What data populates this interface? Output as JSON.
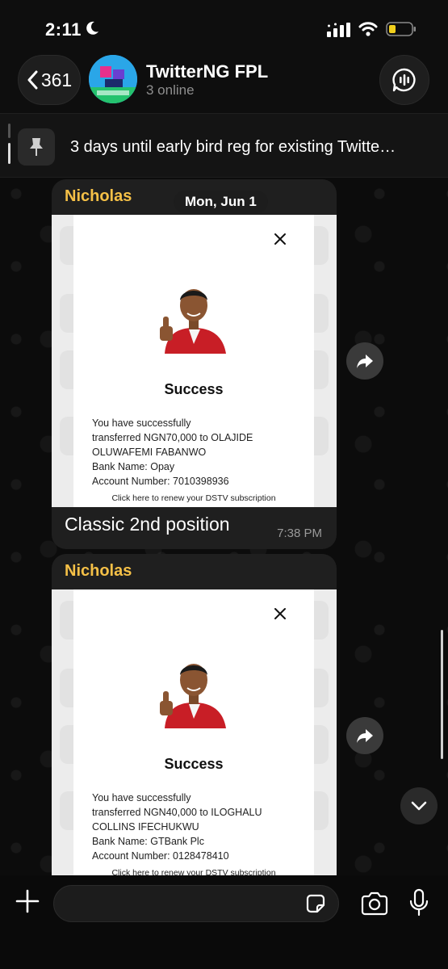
{
  "status_bar": {
    "time": "2:11"
  },
  "header": {
    "back_count": "361",
    "title": "TwitterNG FPL",
    "subtitle": "3 online"
  },
  "pinned": {
    "text": "3 days until early bird reg for existing Twitte…"
  },
  "date_separator": "Mon, Jun 1",
  "messages": [
    {
      "sender": "Nicholas",
      "receipt": {
        "status": "Success",
        "line1": "You have successfully",
        "line2": "transferred NGN70,000 to OLAJIDE",
        "line3": "OLUWAFEMI FABANWO",
        "bank": "Bank Name: Opay",
        "account": "Account Number: 7010398936",
        "renew": "Click here to renew your DSTV subscription"
      },
      "caption": "Classic 2nd position",
      "time": "7:38 PM"
    },
    {
      "sender": "Nicholas",
      "receipt": {
        "status": "Success",
        "line1": "You have successfully",
        "line2": "transferred NGN40,000 to ILOGHALU",
        "line3": "COLLINS IFECHUKWU",
        "bank": "Bank Name: GTBank Plc",
        "account": "Account Number: 0128478410",
        "renew": "Click here to renew your DSTV subscription"
      }
    }
  ],
  "input": {
    "placeholder": ""
  },
  "colors": {
    "sender_name": "#f5c047",
    "bubble": "#1f1f1f",
    "background": "#0e0e0e"
  },
  "icons": [
    "moon-icon",
    "signal-icon",
    "wifi-icon",
    "battery-icon",
    "chevron-left-icon",
    "voice-chat-icon",
    "pin-icon",
    "close-icon",
    "forward-icon",
    "chevron-down-icon",
    "plus-icon",
    "sticker-icon",
    "camera-icon",
    "microphone-icon"
  ]
}
